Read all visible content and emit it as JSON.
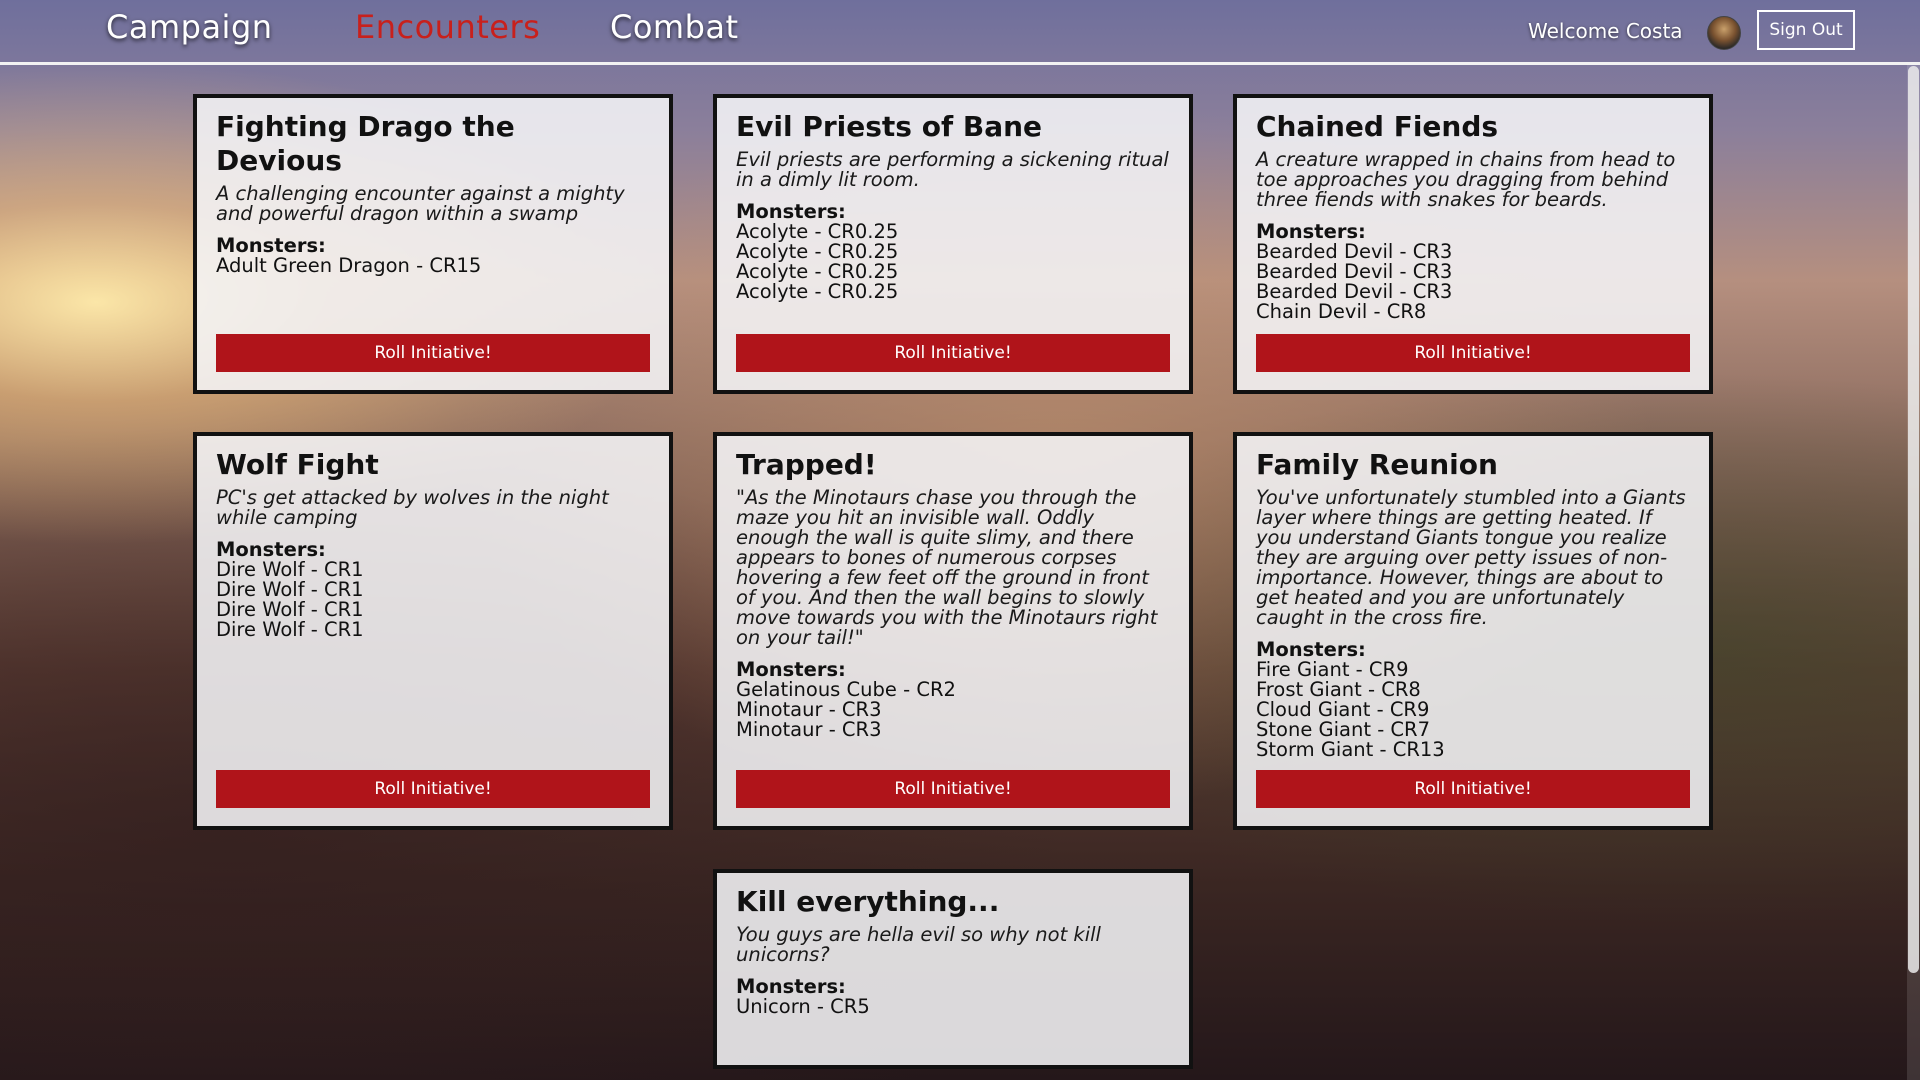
{
  "nav": {
    "links": [
      {
        "label": "Campaign"
      },
      {
        "label": "Encounters"
      },
      {
        "label": "Combat"
      }
    ],
    "active": "Encounters",
    "welcome": "Welcome Costa",
    "sign_out": "Sign Out"
  },
  "colors": {
    "accent_red": "#b0141a",
    "active_nav": "#c8201c",
    "card_bg": "#f4f4f6",
    "card_border": "#111111"
  },
  "encounters": [
    {
      "title": "Fighting Drago the Devious",
      "description": "A challenging encounter against a mighty and powerful dragon within a swamp",
      "monsters_label": "Monsters:",
      "monsters": [
        "Adult Green Dragon - CR15"
      ],
      "button": "Roll Initiative!"
    },
    {
      "title": "Evil Priests of Bane",
      "description": "Evil priests are performing a sickening ritual in a dimly lit room.",
      "monsters_label": "Monsters:",
      "monsters": [
        "Acolyte - CR0.25",
        "Acolyte - CR0.25",
        "Acolyte - CR0.25",
        "Acolyte - CR0.25"
      ],
      "button": "Roll Initiative!"
    },
    {
      "title": "Chained Fiends",
      "description": "A creature wrapped in chains from head to toe approaches you dragging from behind three fiends with snakes for beards.",
      "monsters_label": "Monsters:",
      "monsters": [
        "Bearded Devil - CR3",
        "Bearded Devil - CR3",
        "Bearded Devil - CR3",
        "Chain Devil - CR8"
      ],
      "button": "Roll Initiative!"
    },
    {
      "title": "Wolf Fight",
      "description": "PC's get attacked by wolves in the night while camping",
      "monsters_label": "Monsters:",
      "monsters": [
        "Dire Wolf - CR1",
        "Dire Wolf - CR1",
        "Dire Wolf - CR1",
        "Dire Wolf - CR1"
      ],
      "button": "Roll Initiative!"
    },
    {
      "title": "Trapped!",
      "description": "\"As the Minotaurs chase you through the maze you hit an invisible wall. Oddly enough the wall is quite slimy, and there appears to bones of numerous corpses hovering a few feet off the ground in front of you. And then the wall begins to slowly move towards you with the Minotaurs right on your tail!\"",
      "monsters_label": "Monsters:",
      "monsters": [
        "Gelatinous Cube - CR2",
        "Minotaur - CR3",
        "Minotaur - CR3"
      ],
      "button": "Roll Initiative!"
    },
    {
      "title": "Family Reunion",
      "description": "You've unfortunately stumbled into a Giants layer where things are getting heated. If you understand Giants tongue you realize they are arguing over petty issues of non-importance. However, things are about to get heated and you are unfortunately caught in the cross fire.",
      "monsters_label": "Monsters:",
      "monsters": [
        "Fire Giant - CR9",
        "Frost Giant - CR8",
        "Cloud Giant - CR9",
        "Stone Giant - CR7",
        "Storm Giant - CR13"
      ],
      "button": "Roll Initiative!"
    },
    {
      "title": "Kill everything...",
      "description": "You guys are hella evil so why not kill unicorns?",
      "monsters_label": "Monsters:",
      "monsters": [
        "Unicorn - CR5"
      ],
      "button": ""
    }
  ]
}
